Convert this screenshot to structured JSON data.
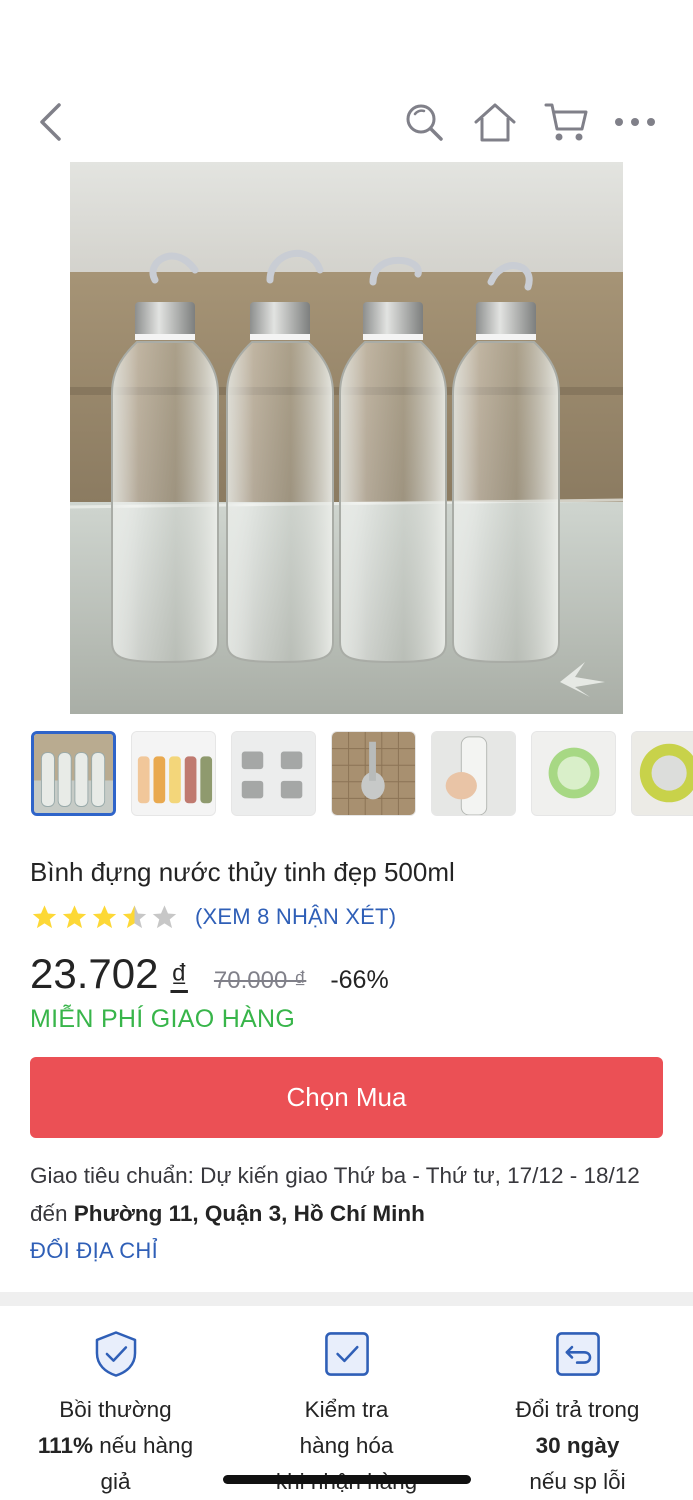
{
  "nav": {
    "back_icon": "chevron-left-icon",
    "search_icon": "search-icon",
    "home_icon": "home-icon",
    "cart_icon": "cart-icon",
    "more_icon": "more-dots-icon"
  },
  "product": {
    "title": "Bình đựng nước thủy tinh đẹp 500ml",
    "rating": 3.5,
    "rating_max": 5,
    "reviews_link": "(XEM 8 NHẬN XÉT)",
    "price": "23.702",
    "currency": "₫",
    "old_price": "70.000 ₫",
    "discount": "-66%",
    "shipping_badge": "MIỄN PHÍ GIAO HÀNG"
  },
  "thumbnails": [
    {
      "name": "thumb-clear-bottles",
      "active": true
    },
    {
      "name": "thumb-colored-bottles",
      "active": false
    },
    {
      "name": "thumb-bottle-caps",
      "active": false
    },
    {
      "name": "thumb-spoon",
      "active": false
    },
    {
      "name": "thumb-hand-bottle",
      "active": false
    },
    {
      "name": "thumb-green-cap",
      "active": false
    },
    {
      "name": "thumb-yellow-cap",
      "active": false
    }
  ],
  "buy_button": "Chọn Mua",
  "delivery": {
    "prefix": "Giao tiêu chuẩn: Dự kiến giao Thứ ba - Thứ tư, 17/12 - 18/12 đến ",
    "address": "Phường 11, Quận 3, Hồ Chí Minh",
    "change_address": "ĐỔI ĐỊA CHỈ"
  },
  "benefits": [
    {
      "icon": "shield-check-icon",
      "line1": "Bồi thường",
      "bold": "111%",
      "line2_rest": " nếu hàng",
      "line3": "giả"
    },
    {
      "icon": "check-box-icon",
      "line1": "Kiểm tra",
      "line2": "hàng hóa",
      "line3": "khi nhận hàng"
    },
    {
      "icon": "return-icon",
      "line1": "Đổi trả trong",
      "bold": "30 ngày",
      "line3": "nếu sp lỗi"
    }
  ],
  "colors": {
    "accent_blue": "#2f5fb7",
    "buy_red": "#eb5055",
    "ship_green": "#38b54a",
    "star_yellow": "#fdd836"
  }
}
